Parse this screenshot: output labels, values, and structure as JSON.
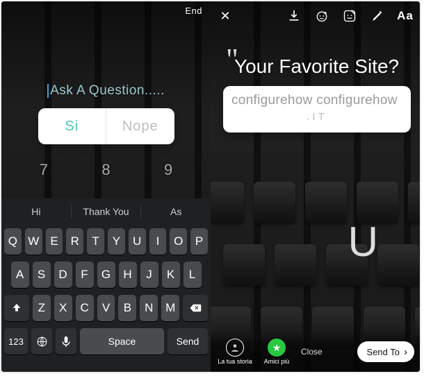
{
  "left": {
    "end_label": "End",
    "question_placeholder": "Ask A Question.....",
    "poll": {
      "option_a": "Si",
      "option_b": "Nope"
    },
    "bg_keys": [
      "7",
      "8",
      "9"
    ],
    "suggestions": {
      "a": "Hi",
      "b": "Thank You",
      "c": "As"
    },
    "keyboard": {
      "row1": [
        "Q",
        "W",
        "E",
        "R",
        "T",
        "Y",
        "U",
        "I",
        "O",
        "P"
      ],
      "row2": [
        "A",
        "S",
        "D",
        "F",
        "G",
        "H",
        "J",
        "K",
        "L"
      ],
      "row3": [
        "Z",
        "X",
        "C",
        "V",
        "B",
        "N",
        "M"
      ],
      "numbers_key": "123",
      "space_key": "Space",
      "send_key": "Send"
    }
  },
  "right": {
    "close_icon": "✕",
    "aa_label": "Aa",
    "quote_mark": "\"",
    "headline": "Your Favorite Site?",
    "sticker": {
      "line1": "configurehow configurehow",
      "line2": ".IT"
    },
    "bg_big_key": "U",
    "your_story_label": "La tua storia",
    "close_friends_label": "Amici più",
    "close_label": "Close",
    "send_to_label": "Send To",
    "send_to_chevron": "›",
    "star_glyph": "★"
  },
  "colors": {
    "accent_teal": "#47c9b9",
    "key_bg": "#4a4b4d",
    "key_mod_bg": "#2f3032",
    "green": "#28c840"
  }
}
